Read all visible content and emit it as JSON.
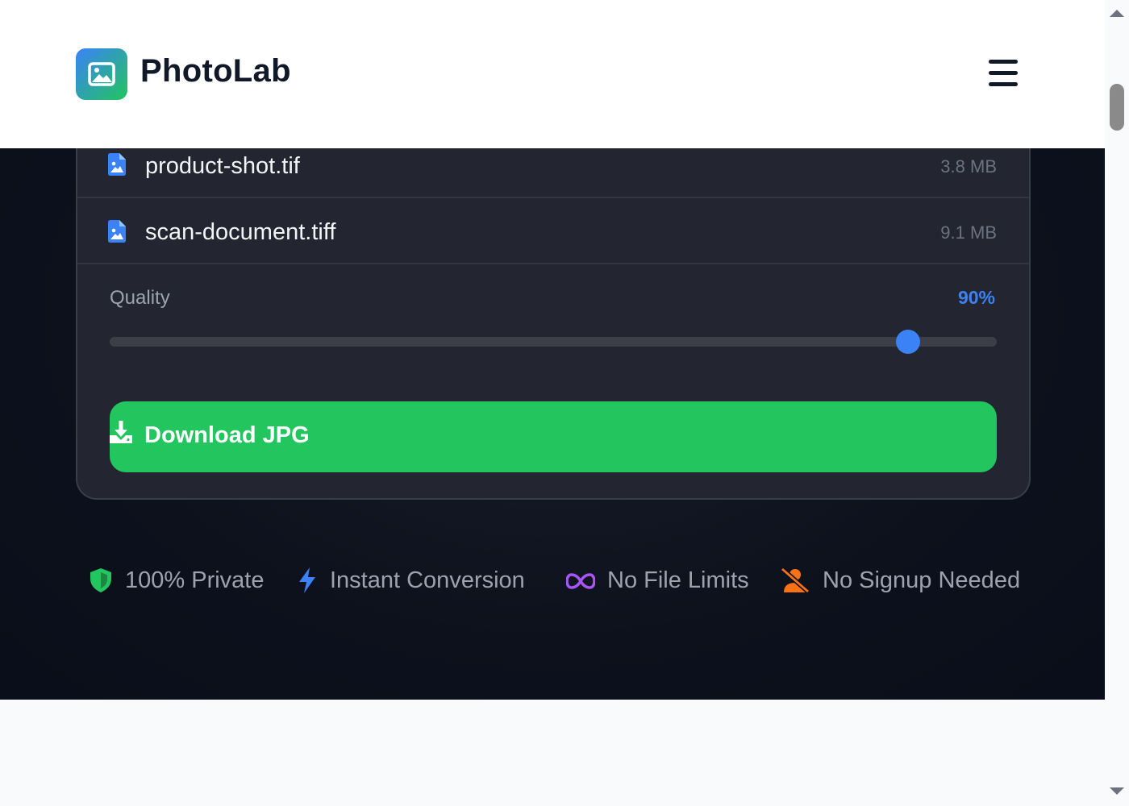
{
  "header": {
    "brand": "PhotoLab",
    "logo_icon": "image-icon",
    "menu_icon": "hamburger-menu-icon"
  },
  "files": [
    {
      "name": "product-shot.tif",
      "size": "3.8 MB",
      "icon": "file-image-icon"
    },
    {
      "name": "scan-document.tiff",
      "size": "9.1 MB",
      "icon": "file-image-icon"
    }
  ],
  "quality": {
    "label": "Quality",
    "value_text": "90%",
    "value": 90
  },
  "download": {
    "label": "Download JPG",
    "icon": "download-icon"
  },
  "features": [
    {
      "label": "100% Private",
      "icon": "shield-icon",
      "color": "#22c55e"
    },
    {
      "label": "Instant Conversion",
      "icon": "bolt-icon",
      "color": "#3b82f6"
    },
    {
      "label": "No File Limits",
      "icon": "infinity-icon",
      "color": "#a855f7"
    },
    {
      "label": "No Signup Needed",
      "icon": "user-slash-icon",
      "color": "#f97316"
    }
  ],
  "colors": {
    "accent": "#3b82f6",
    "success": "#22c55e",
    "card_bg": "#232530",
    "dark_bg": "#0d111c"
  }
}
